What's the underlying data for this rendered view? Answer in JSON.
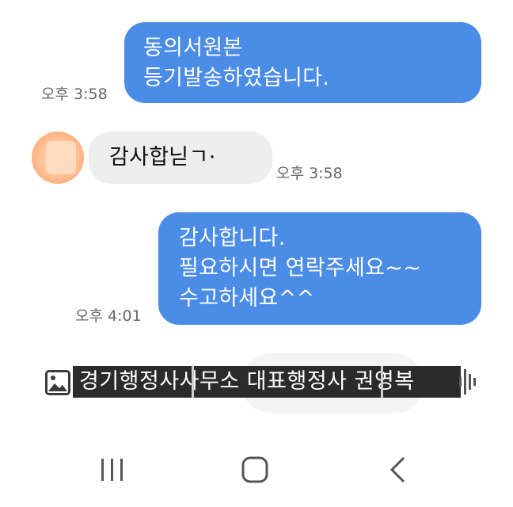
{
  "messages": [
    {
      "direction": "outgoing",
      "lines": [
        "동의서원본",
        "등기발송하였습니다."
      ],
      "time": "오후 3:58"
    },
    {
      "direction": "incoming",
      "lines": [
        "감사합닏ㄱ·"
      ],
      "time": "오후 3:58"
    },
    {
      "direction": "outgoing",
      "lines": [
        "감사합니다.",
        "필요하시면 연락주세요~~",
        "수고하세요^^"
      ],
      "time": "오후 4:01"
    }
  ],
  "overlay": {
    "caption": "경기행정사사무소 대표행정사 권영복",
    "icon": "image-icon"
  },
  "navbar": {
    "icons": [
      "recent-apps-icon",
      "home-icon",
      "back-icon"
    ]
  },
  "colors": {
    "outgoing_bubble": "#4a8ce6",
    "incoming_bubble": "#eeeeee",
    "timestamp": "#666666"
  }
}
